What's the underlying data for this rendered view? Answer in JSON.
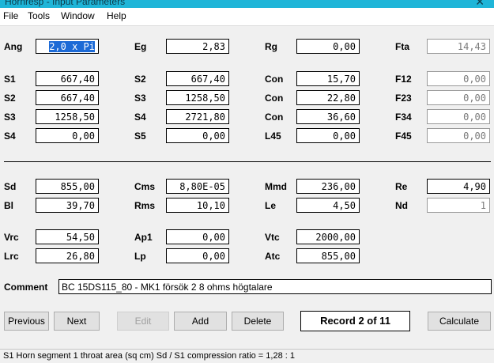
{
  "window": {
    "title": "Hornresp - Input Parameters"
  },
  "menu": [
    "File",
    "Tools",
    "Window",
    "Help"
  ],
  "col1": [
    {
      "label": "Ang",
      "value": "2,0 x Pi"
    },
    {
      "label": "S1",
      "value": "667,40"
    },
    {
      "label": "S2",
      "value": "667,40"
    },
    {
      "label": "S3",
      "value": "1258,50"
    },
    {
      "label": "S4",
      "value": "0,00"
    }
  ],
  "col2": [
    {
      "label": "Eg",
      "value": "2,83"
    },
    {
      "label": "S2",
      "value": "667,40"
    },
    {
      "label": "S3",
      "value": "1258,50"
    },
    {
      "label": "S4",
      "value": "2721,80"
    },
    {
      "label": "S5",
      "value": "0,00"
    }
  ],
  "col3": [
    {
      "label": "Rg",
      "value": "0,00"
    },
    {
      "label": "Con",
      "value": "15,70"
    },
    {
      "label": "Con",
      "value": "22,80"
    },
    {
      "label": "Con",
      "value": "36,60"
    },
    {
      "label": "L45",
      "value": "0,00"
    }
  ],
  "col4": [
    {
      "label": "Fta",
      "value": "14,43"
    },
    {
      "label": "F12",
      "value": "0,00"
    },
    {
      "label": "F23",
      "value": "0,00"
    },
    {
      "label": "F34",
      "value": "0,00"
    },
    {
      "label": "F45",
      "value": "0,00"
    }
  ],
  "driver": {
    "sd": {
      "label": "Sd",
      "value": "855,00"
    },
    "bl": {
      "label": "Bl",
      "value": "39,70"
    },
    "cms": {
      "label": "Cms",
      "value": "8,80E-05"
    },
    "rms": {
      "label": "Rms",
      "value": "10,10"
    },
    "mmd": {
      "label": "Mmd",
      "value": "236,00"
    },
    "le": {
      "label": "Le",
      "value": "4,50"
    },
    "re": {
      "label": "Re",
      "value": "4,90"
    },
    "nd": {
      "label": "Nd",
      "value": "1"
    }
  },
  "chamber": {
    "vrc": {
      "label": "Vrc",
      "value": "54,50"
    },
    "lrc": {
      "label": "Lrc",
      "value": "26,80"
    },
    "ap1": {
      "label": "Ap1",
      "value": "0,00"
    },
    "lp": {
      "label": "Lp",
      "value": "0,00"
    },
    "vtc": {
      "label": "Vtc",
      "value": "2000,00"
    },
    "atc": {
      "label": "Atc",
      "value": "855,00"
    }
  },
  "comment": {
    "label": "Comment",
    "value": "BC 15DS115_80 - MK1 försök 2 8 ohms högtalare"
  },
  "buttons": {
    "previous": "Previous",
    "next": "Next",
    "edit": "Edit",
    "add": "Add",
    "delete": "Delete",
    "calculate": "Calculate"
  },
  "record": "Record 2 of 11",
  "status": "S1   Horn segment 1 throat area  (sq cm)   Sd / S1 compression ratio = 1,28 : 1"
}
